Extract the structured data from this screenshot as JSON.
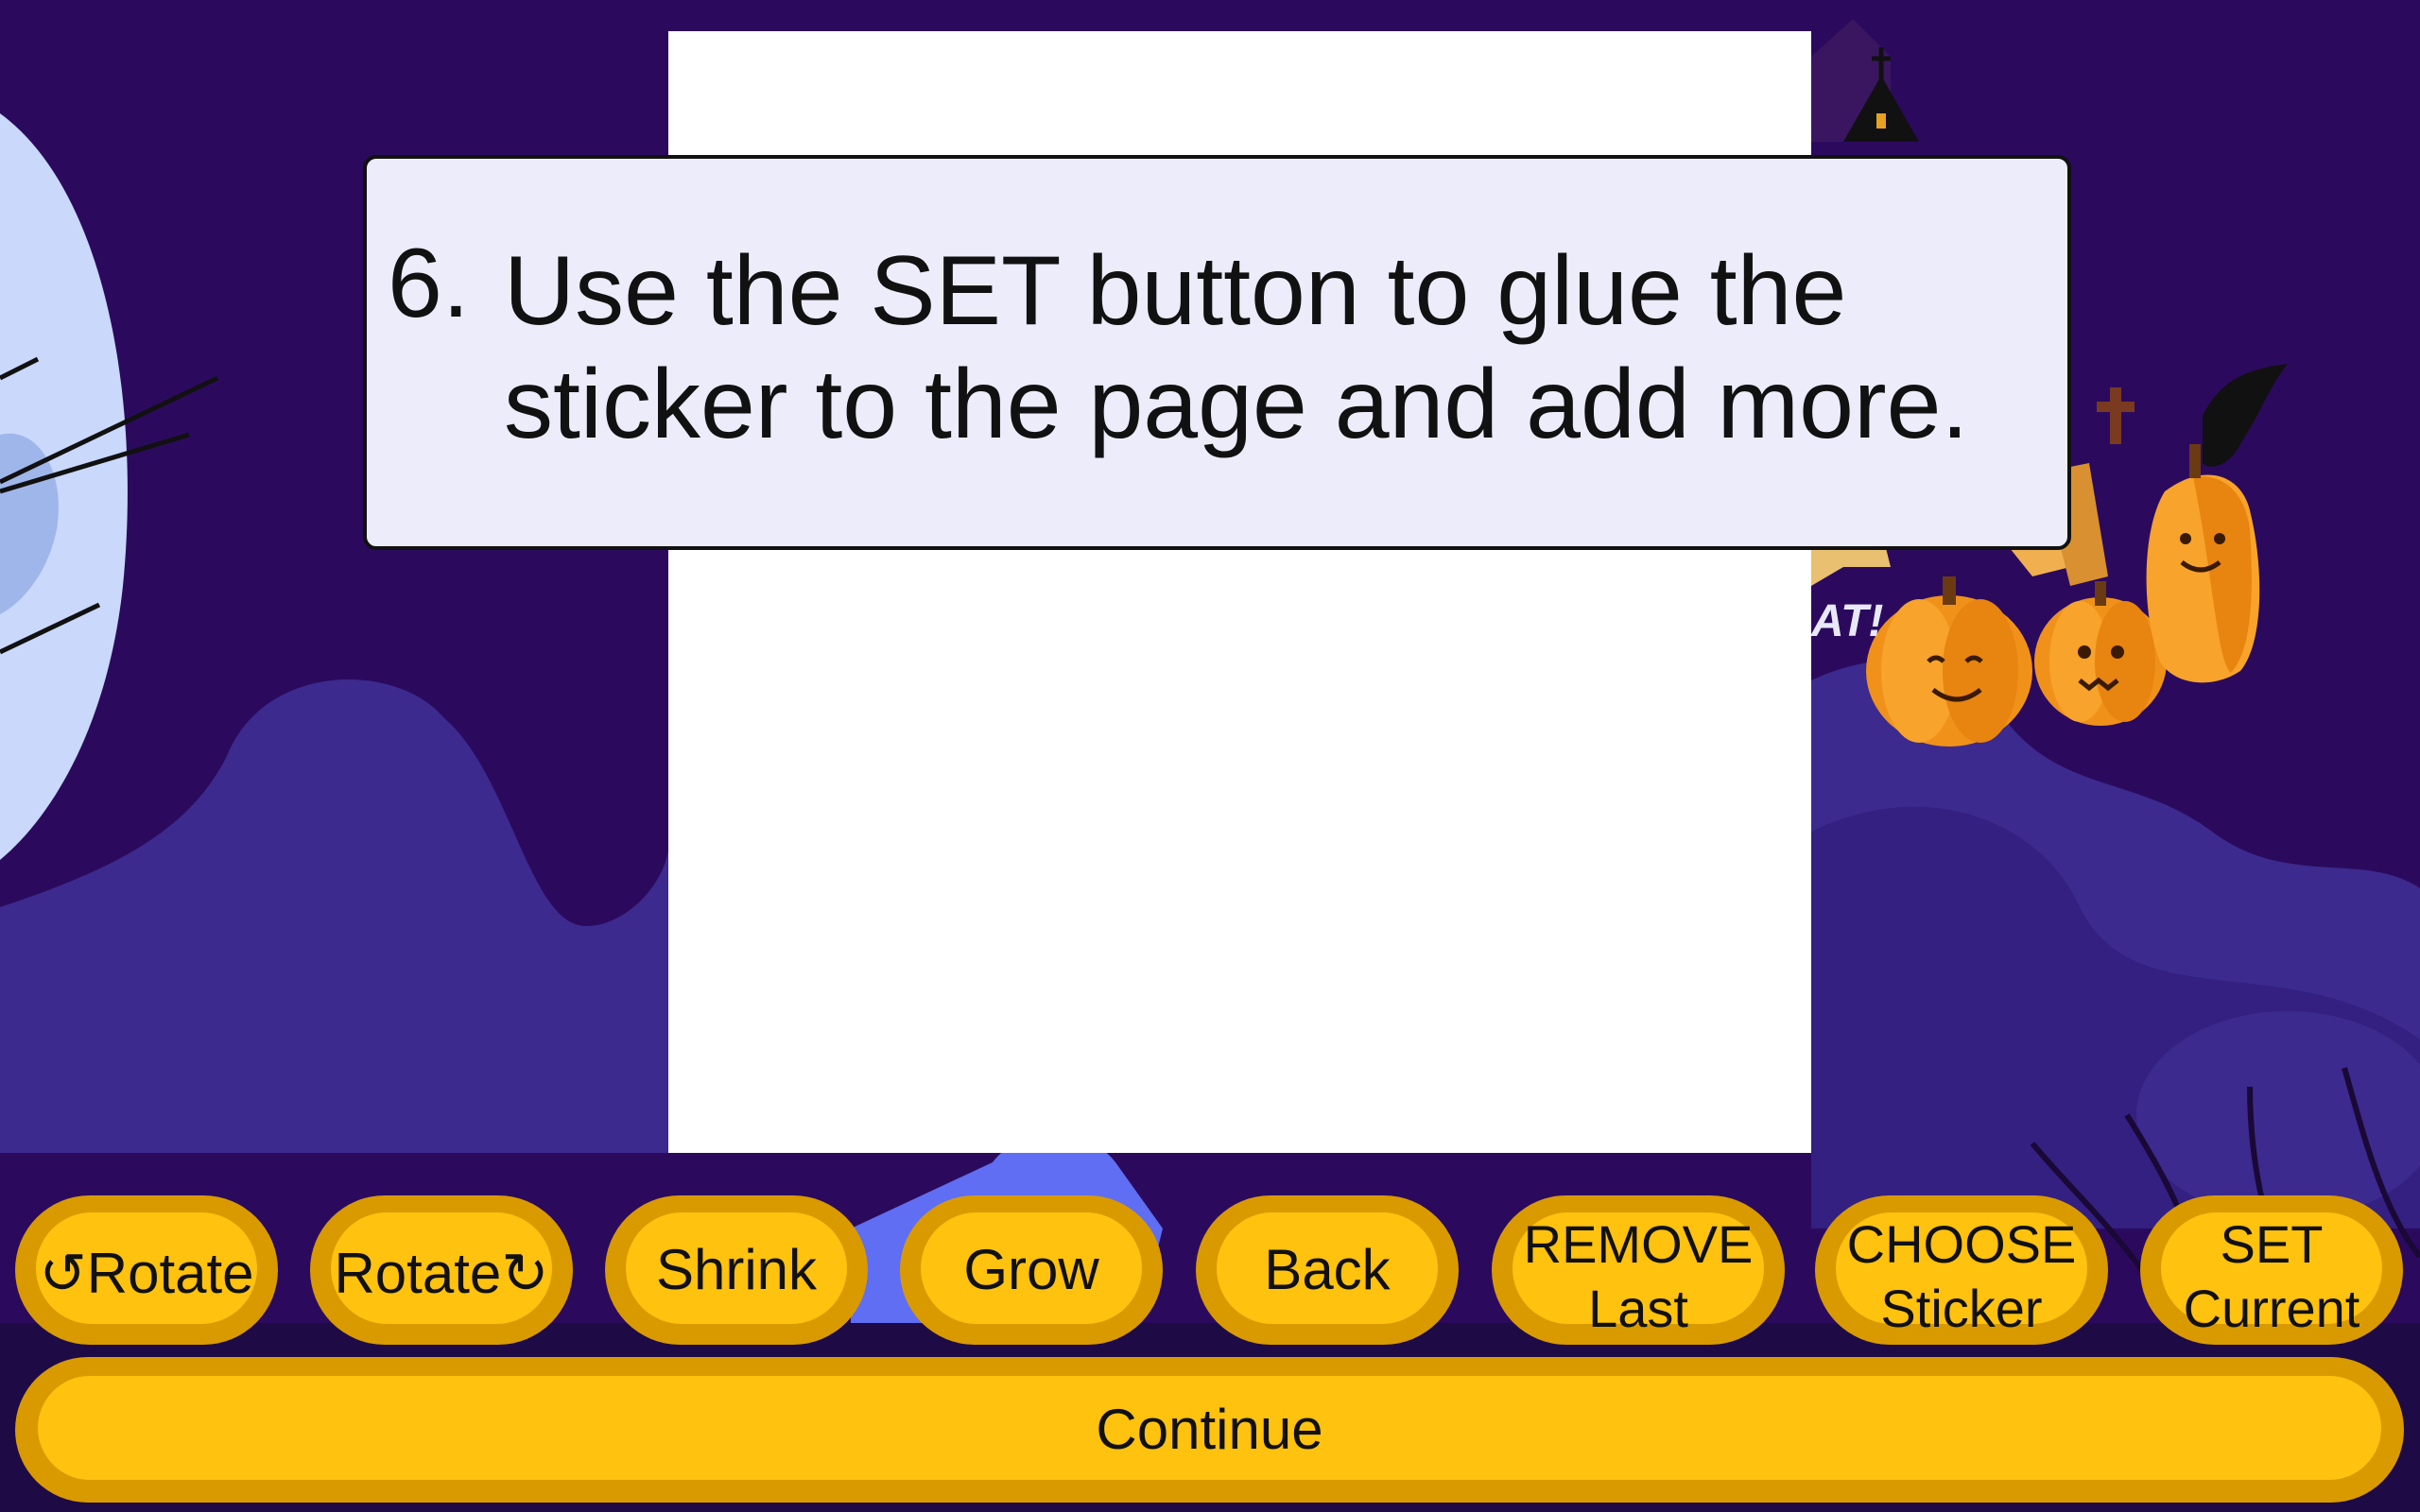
{
  "instruction": {
    "number": "6.",
    "text": "Use the SET button to glue the sticker to the page and add more."
  },
  "buttons": {
    "rotate_left": "↺Rotate",
    "rotate_right": "Rotate↻",
    "shrink": "Shrink",
    "grow": "Grow",
    "back": "Back",
    "remove_last": "REMOVE\nLast",
    "choose_sticker": "CHOOSE\nSticker",
    "set_current": "SET\nCurrent",
    "continue": "Continue"
  },
  "background": {
    "sign_fragment": "AT!"
  },
  "colors": {
    "background": "#2b0a5e",
    "button_face": "#ffc20e",
    "button_rim": "#d99a00",
    "instruction_bg": "#ececfb"
  }
}
